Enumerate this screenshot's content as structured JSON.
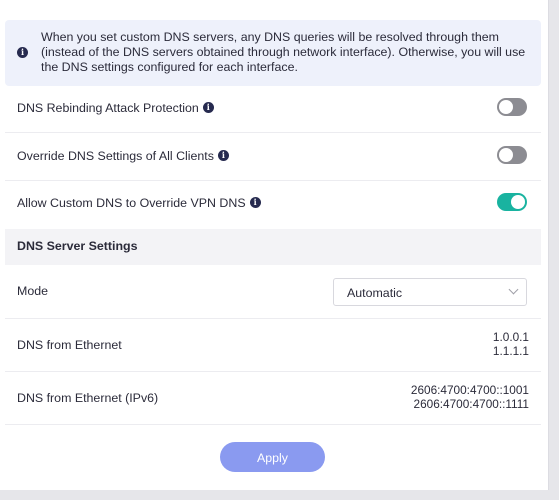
{
  "notice": {
    "text": "When you set custom DNS servers, any DNS queries will be resolved through them (instead of the DNS servers obtained through network interface). Otherwise, you will use the DNS settings configured for each interface."
  },
  "toggles": [
    {
      "label": "DNS Rebinding Attack Protection",
      "on": false
    },
    {
      "label": "Override DNS Settings of All Clients",
      "on": false
    },
    {
      "label": "Allow Custom DNS to Override VPN DNS",
      "on": true
    }
  ],
  "dns_server_settings": {
    "title": "DNS Server Settings",
    "mode": {
      "label": "Mode",
      "value": "Automatic"
    },
    "ethernet": {
      "label": "DNS from Ethernet",
      "values": [
        "1.0.0.1",
        "1.1.1.1"
      ]
    },
    "ethernet_ipv6": {
      "label": "DNS from Ethernet (IPv6)",
      "values": [
        "2606:4700:4700::1001",
        "2606:4700:4700::1111"
      ]
    }
  },
  "apply_label": "Apply",
  "colors": {
    "accent_toggle_on": "#19b3a0",
    "toggle_off": "#8c8c92",
    "apply_button": "#8a9af0",
    "notice_bg": "#eef1fb",
    "info_icon": "#262a4f"
  }
}
